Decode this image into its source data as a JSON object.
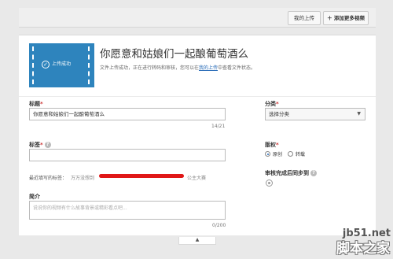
{
  "toolbar": {
    "my_uploads": "我的上传",
    "add_more": "＋ 添加更多视频"
  },
  "upload": {
    "thumb_status": "上传成功",
    "title": "你愿意和姑娘们一起酿葡萄酒么",
    "status_text_1": "文件上传成功，正在进行转码和审核，您可以在",
    "status_link": "我的上传",
    "status_text_2": "中查看文件状态。"
  },
  "form": {
    "title_label": "标题",
    "title_value": "你愿意和姑娘们一起酿葡萄酒么",
    "title_counter": "14/21",
    "tags_label": "标签",
    "tags_value": "",
    "recent_tags_label": "最近填写的标签：",
    "recent_tag_1": "万万没想到",
    "recent_tag_2": "公主大赛",
    "intro_label": "简介",
    "intro_placeholder": "说说你的视频有什么故事背景或精彩看点吧...",
    "intro_counter": "0/200",
    "category_label": "分类",
    "category_value": "选择分类",
    "copyright_label": "版权",
    "copyright_original": "原创",
    "copyright_repost": "转载",
    "sync_label": "审核完成后同步到"
  },
  "bottom": {
    "arrow": "▲"
  },
  "watermark": {
    "site": "jb51.net",
    "name": "脚本之家"
  }
}
